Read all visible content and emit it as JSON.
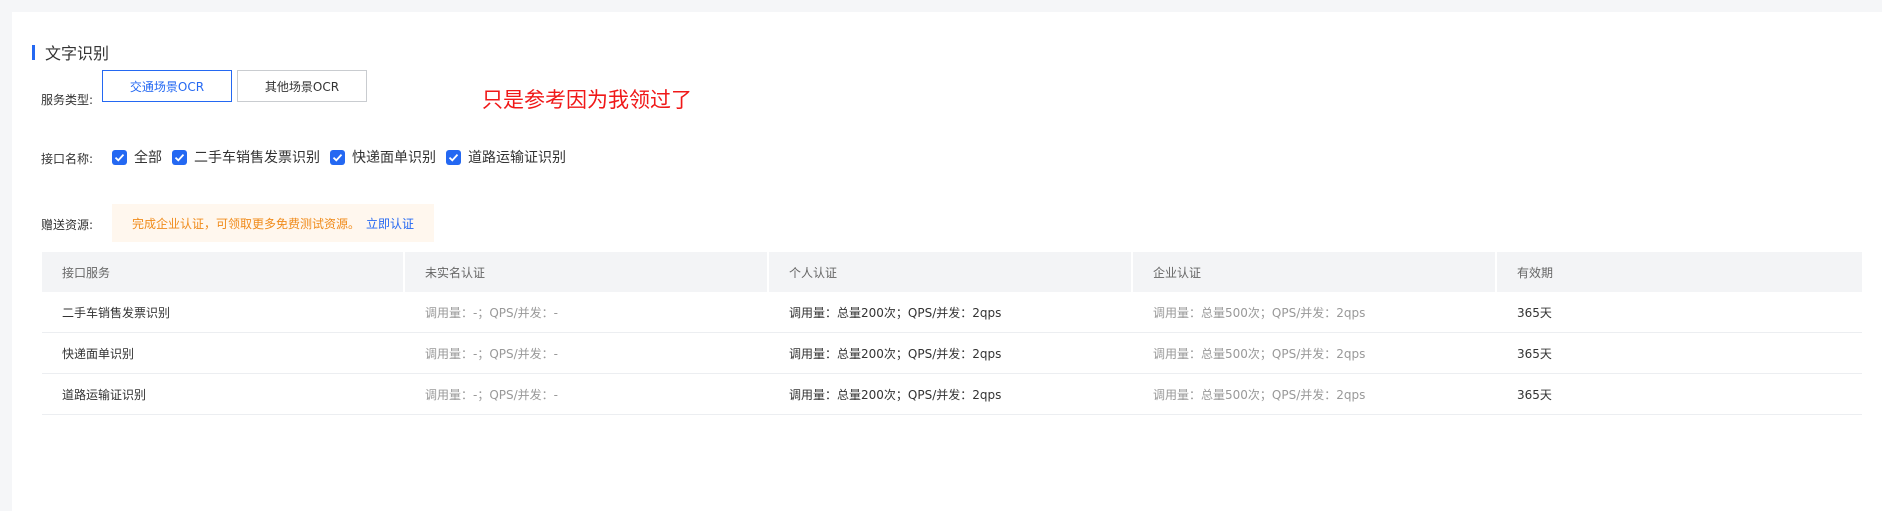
{
  "section": {
    "title": "文字识别"
  },
  "service_type": {
    "label": "服务类型:",
    "buttons": [
      {
        "label": "交通场景OCR",
        "active": true
      },
      {
        "label": "其他场景OCR",
        "active": false
      }
    ]
  },
  "annotation": "只是参考因为我领过了",
  "interface_name": {
    "label": "接口名称:",
    "options": [
      {
        "label": "全部",
        "checked": true
      },
      {
        "label": "二手车销售发票识别",
        "checked": true
      },
      {
        "label": "快递面单识别",
        "checked": true
      },
      {
        "label": "道路运输证识别",
        "checked": true
      }
    ]
  },
  "gift": {
    "label": "赠送资源:",
    "notice": "完成企业认证，可领取更多免费测试资源。",
    "link": "立即认证"
  },
  "table": {
    "headers": [
      "接口服务",
      "未实名认证",
      "个人认证",
      "企业认证",
      "有效期"
    ],
    "rows": [
      [
        "二手车销售发票识别",
        "调用量：-；QPS/并发：-",
        "调用量：总量200次；QPS/并发：2qps",
        "调用量：总量500次；QPS/并发：2qps",
        "365天"
      ],
      [
        "快递面单识别",
        "调用量：-；QPS/并发：-",
        "调用量：总量200次；QPS/并发：2qps",
        "调用量：总量500次；QPS/并发：2qps",
        "365天"
      ],
      [
        "道路运输证识别",
        "调用量：-；QPS/并发：-",
        "调用量：总量200次；QPS/并发：2qps",
        "调用量：总量500次；QPS/并发：2qps",
        "365天"
      ]
    ]
  },
  "colors": {
    "primary": "#2468f2",
    "warning": "#f08b1a",
    "annotation": "#f01818"
  }
}
